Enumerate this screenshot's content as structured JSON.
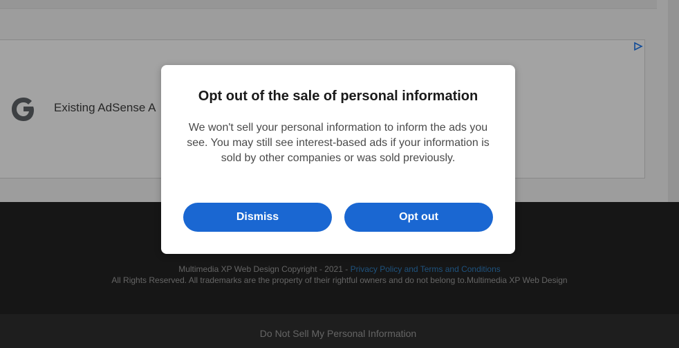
{
  "ad": {
    "text": "Existing AdSense A",
    "icons": [
      "google-g-logo",
      "adchoices-icon"
    ]
  },
  "footer": {
    "copyright_prefix": "Multimedia XP Web Design Copyright - 2021 - ",
    "policy_link": "Privacy Policy and Terms and Conditions",
    "rights": "All Rights Reserved. All trademarks are the property of their rightful owners and do not belong to.Multimedia XP Web Design",
    "do_not_sell_link": "Do Not Sell My Personal Information"
  },
  "modal": {
    "title": "Opt out of the sale of personal information",
    "body": "We won't sell your personal information to inform the ads you see. You may still see interest-based ads if your information is sold by other companies or was sold previously.",
    "dismiss_label": "Dismiss",
    "optout_label": "Opt out"
  },
  "colors": {
    "button_blue": "#1a67d2",
    "footer_bg": "#232323",
    "link_blue": "#2f7ec0"
  }
}
